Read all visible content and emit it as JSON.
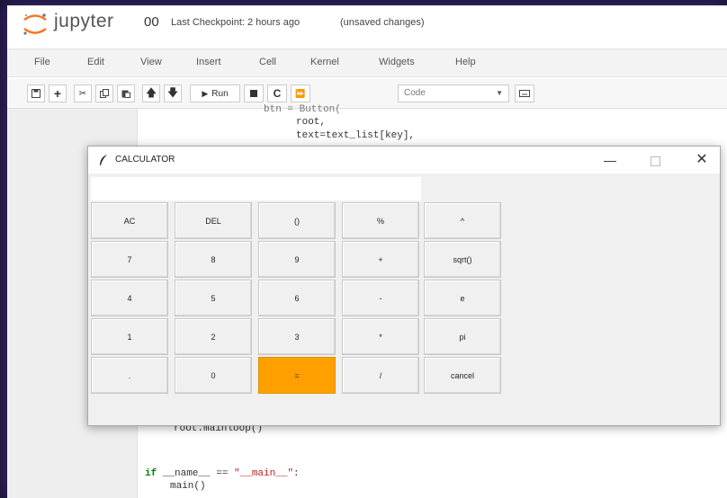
{
  "header": {
    "brand": "jupyter",
    "notebook_title": "00",
    "checkpoint": "Last Checkpoint: 2 hours ago",
    "unsaved": "(unsaved changes)"
  },
  "menu": [
    "File",
    "Edit",
    "View",
    "Insert",
    "Cell",
    "Kernel",
    "Widgets",
    "Help"
  ],
  "toolbar": {
    "run_label": "Run",
    "cell_type": "Code"
  },
  "code": {
    "line_partial": "btn = Button(",
    "line_root": "root,",
    "line_text": "text=text_list[key],",
    "line_mainloop": "root.mainloop()",
    "line_if_kw": "if",
    "line_if_rest": " __name__ == ",
    "line_if_str": "\"__main__\"",
    "line_if_colon": ":",
    "line_main": "main()"
  },
  "calculator": {
    "title": "CALCULATOR",
    "display_value": "",
    "keys": [
      [
        "AC",
        "DEL",
        "()",
        "%",
        "^"
      ],
      [
        "7",
        "8",
        "9",
        "+",
        "sqrt()"
      ],
      [
        "4",
        "5",
        "6",
        "-",
        "e"
      ],
      [
        "1",
        "2",
        "3",
        "*",
        "pi"
      ],
      [
        ".",
        "0",
        "=",
        "/",
        "cancel"
      ]
    ],
    "accent_key": "=",
    "accent_color": "#ffa000"
  }
}
